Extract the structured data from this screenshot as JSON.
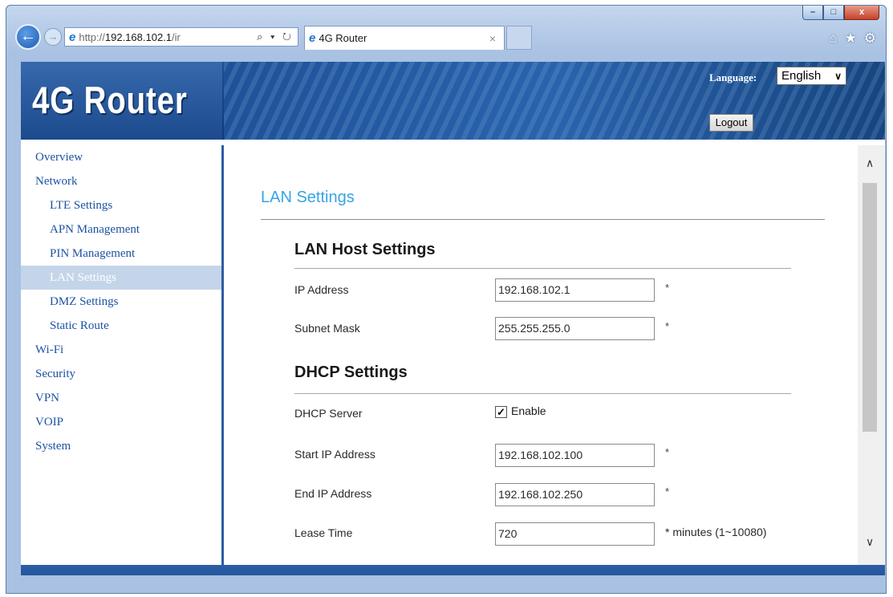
{
  "browser": {
    "window_controls": [
      "–",
      "□",
      "x"
    ],
    "address": {
      "url_prefix": "http://",
      "url_host": "192.168.102.1",
      "url_tail": "/ir",
      "tools": "⌕ ▾ ↻"
    },
    "tab": {
      "title": "4G Router",
      "close": "×"
    },
    "toolbar_icons": [
      "home-icon",
      "star-icon",
      "gear-icon"
    ]
  },
  "header": {
    "logo": "4G Router",
    "language_label": "Language:",
    "language_value": "English",
    "logout": "Logout"
  },
  "sidebar": {
    "items": [
      {
        "label": "Overview",
        "level": "top",
        "active": false
      },
      {
        "label": "Network",
        "level": "top",
        "active": false
      },
      {
        "label": "LTE Settings",
        "level": "sub",
        "active": false
      },
      {
        "label": "APN Management",
        "level": "sub",
        "active": false
      },
      {
        "label": "PIN Management",
        "level": "sub",
        "active": false
      },
      {
        "label": "LAN Settings",
        "level": "sub",
        "active": true
      },
      {
        "label": "DMZ Settings",
        "level": "sub",
        "active": false
      },
      {
        "label": "Static Route",
        "level": "sub",
        "active": false
      },
      {
        "label": "Wi-Fi",
        "level": "top",
        "active": false
      },
      {
        "label": "Security",
        "level": "top",
        "active": false
      },
      {
        "label": "VPN",
        "level": "top",
        "active": false
      },
      {
        "label": "VOIP",
        "level": "top",
        "active": false
      },
      {
        "label": "System",
        "level": "top",
        "active": false
      }
    ]
  },
  "main": {
    "title": "LAN Settings",
    "lan_host": {
      "heading": "LAN Host Settings",
      "ip_label": "IP Address",
      "ip_value": "192.168.102.1",
      "mask_label": "Subnet Mask",
      "mask_value": "255.255.255.0"
    },
    "dhcp": {
      "heading": "DHCP Settings",
      "server_label": "DHCP Server",
      "server_checked": true,
      "server_option": "Enable",
      "start_label": "Start IP Address",
      "start_value": "192.168.102.100",
      "end_label": "End IP Address",
      "end_value": "192.168.102.250",
      "lease_label": "Lease Time",
      "lease_value": "720",
      "lease_note": "* minutes (1~10080)"
    },
    "required_mark": "*"
  },
  "colors": {
    "link": "#1d52a3",
    "page_title": "#37a3e6",
    "banner_dark": "#0f3a77",
    "sidebar_active_bg": "#c4d5ea"
  }
}
